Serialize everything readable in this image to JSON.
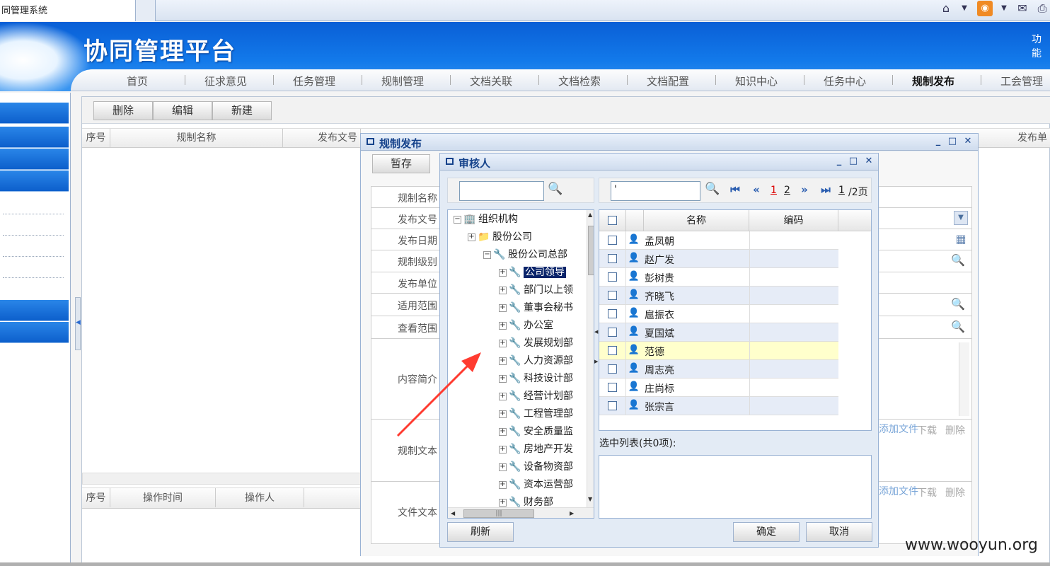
{
  "browser": {
    "tab_title": "同管理系统"
  },
  "header": {
    "logo": "协同管理平台",
    "top_link": "功能"
  },
  "nav": {
    "items": [
      "首页",
      "征求意见",
      "任务管理",
      "规制管理",
      "文档关联",
      "文档检索",
      "文档配置",
      "知识中心",
      "任务中心",
      "规制发布",
      "工会管理"
    ],
    "active": "规制发布"
  },
  "main": {
    "toolbar": {
      "delete": "删除",
      "edit": "编辑",
      "new": "新建"
    },
    "columns": [
      "序号",
      "规制名称",
      "发布文号",
      "发布单"
    ],
    "log_columns": [
      "序号",
      "操作时间",
      "操作人"
    ]
  },
  "release_dialog": {
    "title": "规制发布",
    "save_draft": "暂存",
    "labels": [
      "规制名称",
      "发布文号",
      "发布日期",
      "规制级别",
      "发布单位",
      "适用范围",
      "查看范围",
      "内容简介",
      "规制文本",
      "文件文本"
    ],
    "attach_link": "添加文件",
    "download": "下载",
    "delete": "删除"
  },
  "reviewer_dialog": {
    "title": "审核人",
    "tree_search_value": "",
    "grid_search_value": "'",
    "pagination": {
      "pages": [
        "1",
        "2"
      ],
      "current": "1",
      "total": "/2页"
    },
    "tree": [
      {
        "label": "组织机构",
        "level": 0,
        "expander": "−"
      },
      {
        "label": "股份公司",
        "level": 1,
        "expander": "+"
      },
      {
        "label": "股份公司总部",
        "level": 2,
        "expander": "−"
      },
      {
        "label": "公司领导",
        "level": 3,
        "expander": "+",
        "selected": true
      },
      {
        "label": "部门以上领",
        "level": 3,
        "expander": "+"
      },
      {
        "label": "董事会秘书",
        "level": 3,
        "expander": "+"
      },
      {
        "label": "办公室",
        "level": 3,
        "expander": "+"
      },
      {
        "label": "发展规划部",
        "level": 3,
        "expander": "+"
      },
      {
        "label": "人力资源部",
        "level": 3,
        "expander": "+"
      },
      {
        "label": "科技设计部",
        "level": 3,
        "expander": "+"
      },
      {
        "label": "经营计划部",
        "level": 3,
        "expander": "+"
      },
      {
        "label": "工程管理部",
        "level": 3,
        "expander": "+"
      },
      {
        "label": "安全质量监",
        "level": 3,
        "expander": "+"
      },
      {
        "label": "房地产开发",
        "level": 3,
        "expander": "+"
      },
      {
        "label": "设备物资部",
        "level": 3,
        "expander": "+"
      },
      {
        "label": "资本运营部",
        "level": 3,
        "expander": "+"
      },
      {
        "label": "财务部",
        "level": 3,
        "expander": "+"
      }
    ],
    "grid_columns": {
      "name": "名称",
      "code": "编码"
    },
    "users": [
      {
        "name": "孟凤朝",
        "code": ""
      },
      {
        "name": "赵广发",
        "code": ""
      },
      {
        "name": "彭树贵",
        "code": ""
      },
      {
        "name": "齐晓飞",
        "code": ""
      },
      {
        "name": "扈振衣",
        "code": ""
      },
      {
        "name": "夏国斌",
        "code": ""
      },
      {
        "name": "范德",
        "code": ""
      },
      {
        "name": "周志亮",
        "code": ""
      },
      {
        "name": "庄尚标",
        "code": ""
      },
      {
        "name": "张宗言",
        "code": ""
      }
    ],
    "selected_list_label": "选中列表(共0项):",
    "refresh": "刷新",
    "confirm": "确定",
    "cancel": "取消"
  },
  "watermark": "www.wooyun.org",
  "colors": {
    "header_blue": "#1279ea",
    "dialog_title": "#15428b",
    "row_alt": "#e6ecf7",
    "row_hover": "#ffffcc",
    "arrow": "#ff3b30"
  }
}
